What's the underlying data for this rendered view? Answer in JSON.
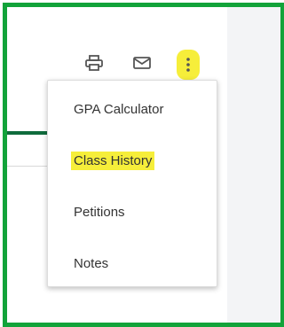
{
  "toolbar": {
    "print_icon": "printer-icon",
    "mail_icon": "envelope-icon",
    "more_icon": "vertical-ellipsis-icon"
  },
  "menu": {
    "items": [
      {
        "label": "GPA Calculator",
        "highlighted": false
      },
      {
        "label": "Class History",
        "highlighted": true
      },
      {
        "label": "Petitions",
        "highlighted": false
      },
      {
        "label": "Notes",
        "highlighted": false
      }
    ]
  },
  "colors": {
    "frame_border": "#12a33a",
    "highlight": "#f6ee3a",
    "accent": "#0f6b3c",
    "icon": "#555555",
    "text": "#333333"
  }
}
